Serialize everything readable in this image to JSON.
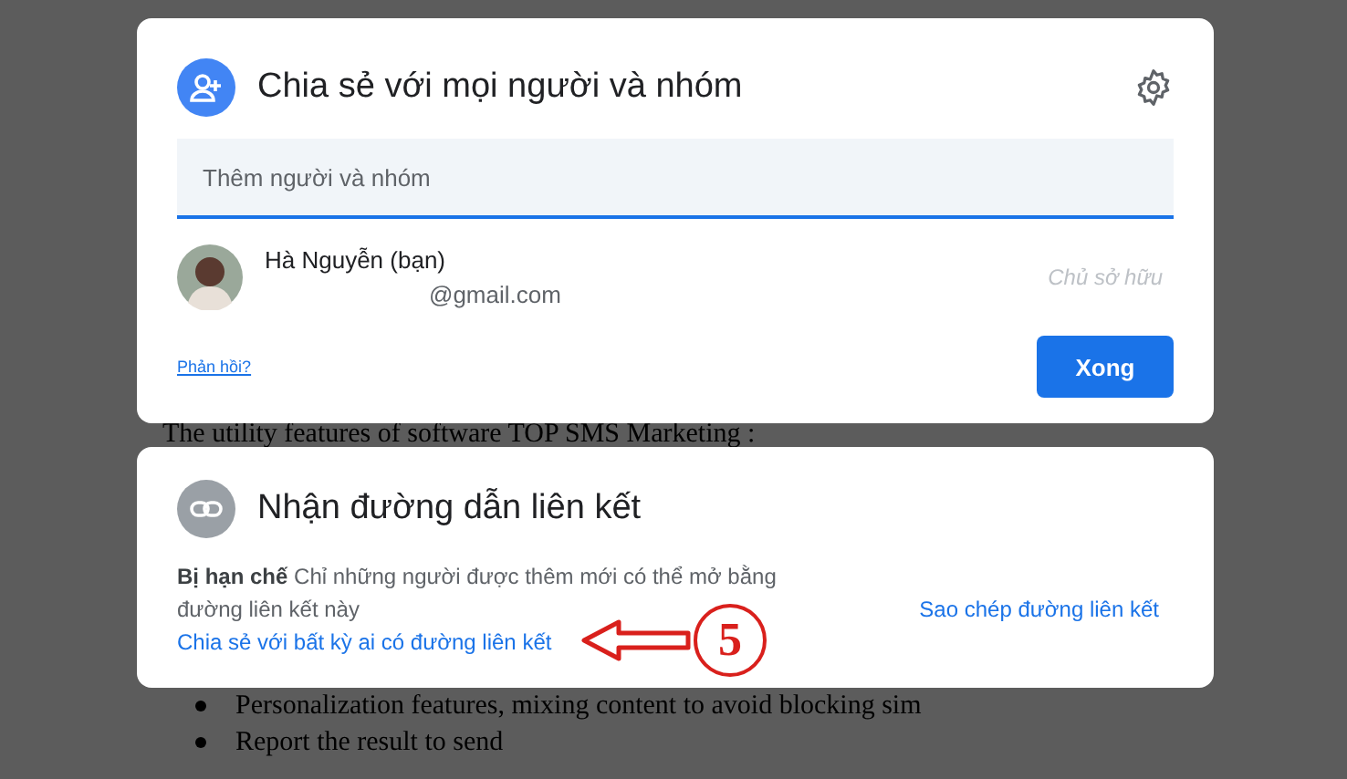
{
  "share_dialog": {
    "title": "Chia sẻ với mọi người và nhóm",
    "add_field": {
      "placeholder": "Thêm người và nhóm"
    },
    "people": [
      {
        "name": "Hà Nguyễn (bạn)",
        "email": "@gmail.com",
        "role": "Chủ sở hữu"
      }
    ],
    "feedback_link": "Phản hồi?",
    "done_button": "Xong"
  },
  "background_text": "The utility features of software TOP SMS Marketing :",
  "link_dialog": {
    "title": "Nhận đường dẫn liên kết",
    "description": "**Bị hạn chế** Chỉ những người được thêm mới có thể mở bằng đường liên kết này",
    "share_link": "Chia sẻ với bất kỳ ai có đường liên kết",
    "copy_link": "Sao chép đường liên kết"
  },
  "annotation": {
    "label": "5"
  },
  "background_bullets": [
    "Personalization features, mixing content to avoid blocking sim",
    "Report the result to send"
  ]
}
